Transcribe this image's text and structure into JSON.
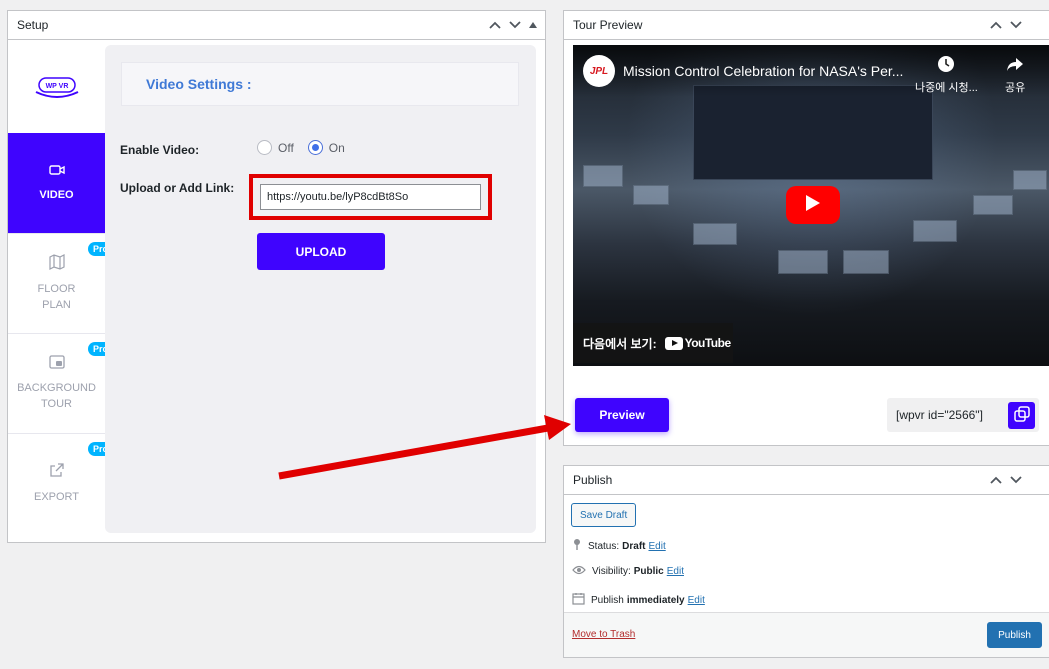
{
  "setup_box": {
    "title": "Setup",
    "logo_text": "WP VR",
    "nav": [
      {
        "label": "VIDEO",
        "icon": "video-camera-icon",
        "pro": ""
      },
      {
        "label": "FLOOR\nPLAN",
        "icon": "map-icon",
        "pro": "Pro"
      },
      {
        "label": "BACKGROUND\nTOUR",
        "icon": "picture-in-picture-icon",
        "pro": "Pro"
      },
      {
        "label": "EXPORT",
        "icon": "export-icon",
        "pro": "Pro"
      }
    ],
    "section_heading": "Video Settings :",
    "enable_video_label": "Enable Video:",
    "off_label": "Off",
    "on_label": "On",
    "enable_video_selected": "On",
    "upload_label": "Upload or Add Link:",
    "upload_value": "https://youtu.be/lyP8cdBt8So",
    "upload_button": "UPLOAD"
  },
  "tour_preview": {
    "title": "Tour Preview",
    "video": {
      "channel_logo": "JPL",
      "title": "Mission Control Celebration for NASA's Per...",
      "watch_later": "나중에 시청...",
      "share": "공유",
      "watch_on": "다음에서 보기:",
      "youtube_text": "YouTube"
    },
    "preview_button": "Preview",
    "shortcode": "[wpvr id=\"2566\"]"
  },
  "publish_box": {
    "title": "Publish",
    "save_draft": "Save Draft",
    "status_label": "Status:",
    "status_value": "Draft",
    "visibility_label": "Visibility:",
    "visibility_value": "Public",
    "publish_label": "Publish",
    "publish_value": "immediately",
    "edit_link": "Edit",
    "move_to_trash": "Move to Trash",
    "publish_button": "Publish"
  },
  "colors": {
    "accent": "#3f04fe",
    "pro_badge": "#00b4ff",
    "wp_blue": "#2271b1",
    "annotation_red": "#e00000"
  }
}
